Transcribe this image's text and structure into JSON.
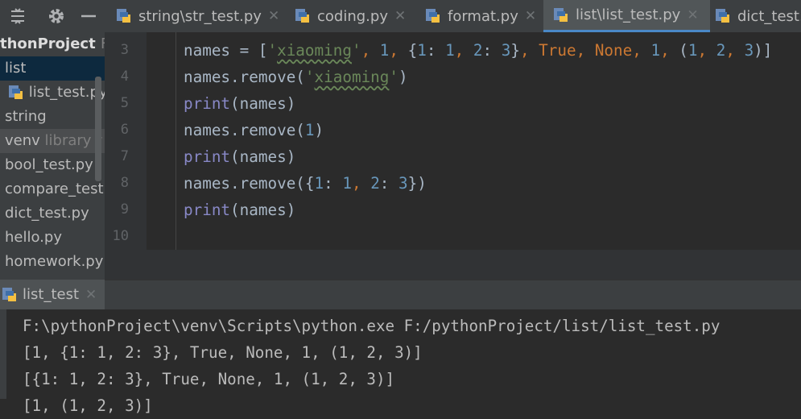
{
  "toolbar": {
    "collapse_icon": "collapse-all-icon",
    "settings_icon": "gear-icon",
    "hide_icon": "minimize-icon"
  },
  "tabs": [
    {
      "label": "string\\str_test.py",
      "active": false
    },
    {
      "label": "coding.py",
      "active": false
    },
    {
      "label": "format.py",
      "active": false
    },
    {
      "label": "list\\list_test.py",
      "active": true
    },
    {
      "label": "dict_test.py",
      "active": false
    }
  ],
  "project": {
    "root": "thonProject",
    "root_suffix": "F",
    "items": [
      {
        "label": "list",
        "suffix": ""
      },
      {
        "label": "list_test.py",
        "suffix": ""
      },
      {
        "label": "string",
        "suffix": ""
      },
      {
        "label": "venv",
        "suffix": "library r"
      },
      {
        "label": "bool_test.py",
        "suffix": ""
      },
      {
        "label": "compare_test.p",
        "suffix": ""
      },
      {
        "label": "dict_test.py",
        "suffix": ""
      },
      {
        "label": "hello.py",
        "suffix": ""
      },
      {
        "label": "homework.py",
        "suffix": ""
      }
    ]
  },
  "editor": {
    "line_numbers": [
      "3",
      "4",
      "5",
      "6",
      "7",
      "8",
      "9",
      "10"
    ],
    "code": [
      "names = ['xiaoming', 1, {1: 1, 2: 3}, True, None, 1, (1, 2, 3)]",
      "names.remove('xiaoming')",
      "print(names)",
      "names.remove(1)",
      "print(names)",
      "names.remove({1: 1, 2: 3})",
      "print(names)",
      ""
    ]
  },
  "run": {
    "tab_label": "list_test",
    "output": [
      "F:\\pythonProject\\venv\\Scripts\\python.exe F:/pythonProject/list/list_test.py",
      "[1, {1: 1, 2: 3}, True, None, 1, (1, 2, 3)]",
      "[{1: 1, 2: 3}, True, None, 1, (1, 2, 3)]",
      "[1, (1, 2, 3)]"
    ]
  },
  "colors": {
    "keyword": "#cc7832",
    "number": "#6897bb",
    "string": "#6a8759",
    "builtin": "#8888c6",
    "text": "#a9b7c6",
    "accent": "#4a88c7"
  }
}
